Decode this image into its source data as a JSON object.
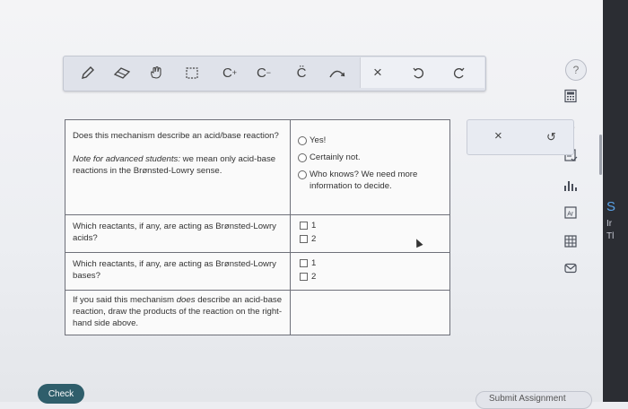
{
  "toolbar": {
    "tools": [
      {
        "icon": "pencil-icon"
      },
      {
        "icon": "eraser-icon"
      },
      {
        "icon": "hand-icon"
      },
      {
        "icon": "select-box-icon"
      },
      {
        "icon": "cation-icon",
        "label": "C",
        "sup": "+"
      },
      {
        "icon": "anion-icon",
        "label": "C",
        "sup": "−"
      },
      {
        "icon": "lone-pair-icon",
        "label": "C̈"
      },
      {
        "icon": "arrow-curve-icon"
      },
      {
        "icon": "close-icon"
      },
      {
        "icon": "undo-icon"
      },
      {
        "icon": "redo-icon"
      }
    ]
  },
  "help_label": "?",
  "question": {
    "rows": [
      {
        "question": "Does this mechanism describe an acid/base reaction?",
        "note_prefix": "Note for advanced students:",
        "note_rest": " we mean only acid-base reactions in the Brønsted-Lowry sense.",
        "type": "radio",
        "options": [
          "Yes!",
          "Certainly not.",
          "Who knows? We need more information to decide."
        ]
      },
      {
        "question": "Which reactants, if any, are acting as Brønsted-Lowry acids?",
        "type": "checkbox",
        "options": [
          "1",
          "2"
        ]
      },
      {
        "question": "Which reactants, if any, are acting as Brønsted-Lowry bases?",
        "type": "checkbox",
        "options": [
          "1",
          "2"
        ]
      },
      {
        "question_prefix": "If you said this mechanism ",
        "question_em": "does",
        "question_rest": " describe an acid-base reaction, draw the products of the reaction on the right-hand side above.",
        "type": "none"
      }
    ]
  },
  "answer_panel": {
    "close_symbol": "×",
    "undo_symbol": "↺"
  },
  "side_icons": [
    "infinity-icon",
    "calculator-icon",
    "checklist-icon",
    "chart-icon",
    "periodic-table-icon",
    "grid-icon",
    "mail-icon"
  ],
  "buttons": {
    "check": "Check",
    "submit": "Submit Assignment"
  },
  "edge_text": [
    "S",
    "Ir",
    "Tl"
  ],
  "colors": {
    "check_button": "#2f5e6b",
    "toolbar": "#dfe2ea",
    "page": "#ecedf1"
  }
}
